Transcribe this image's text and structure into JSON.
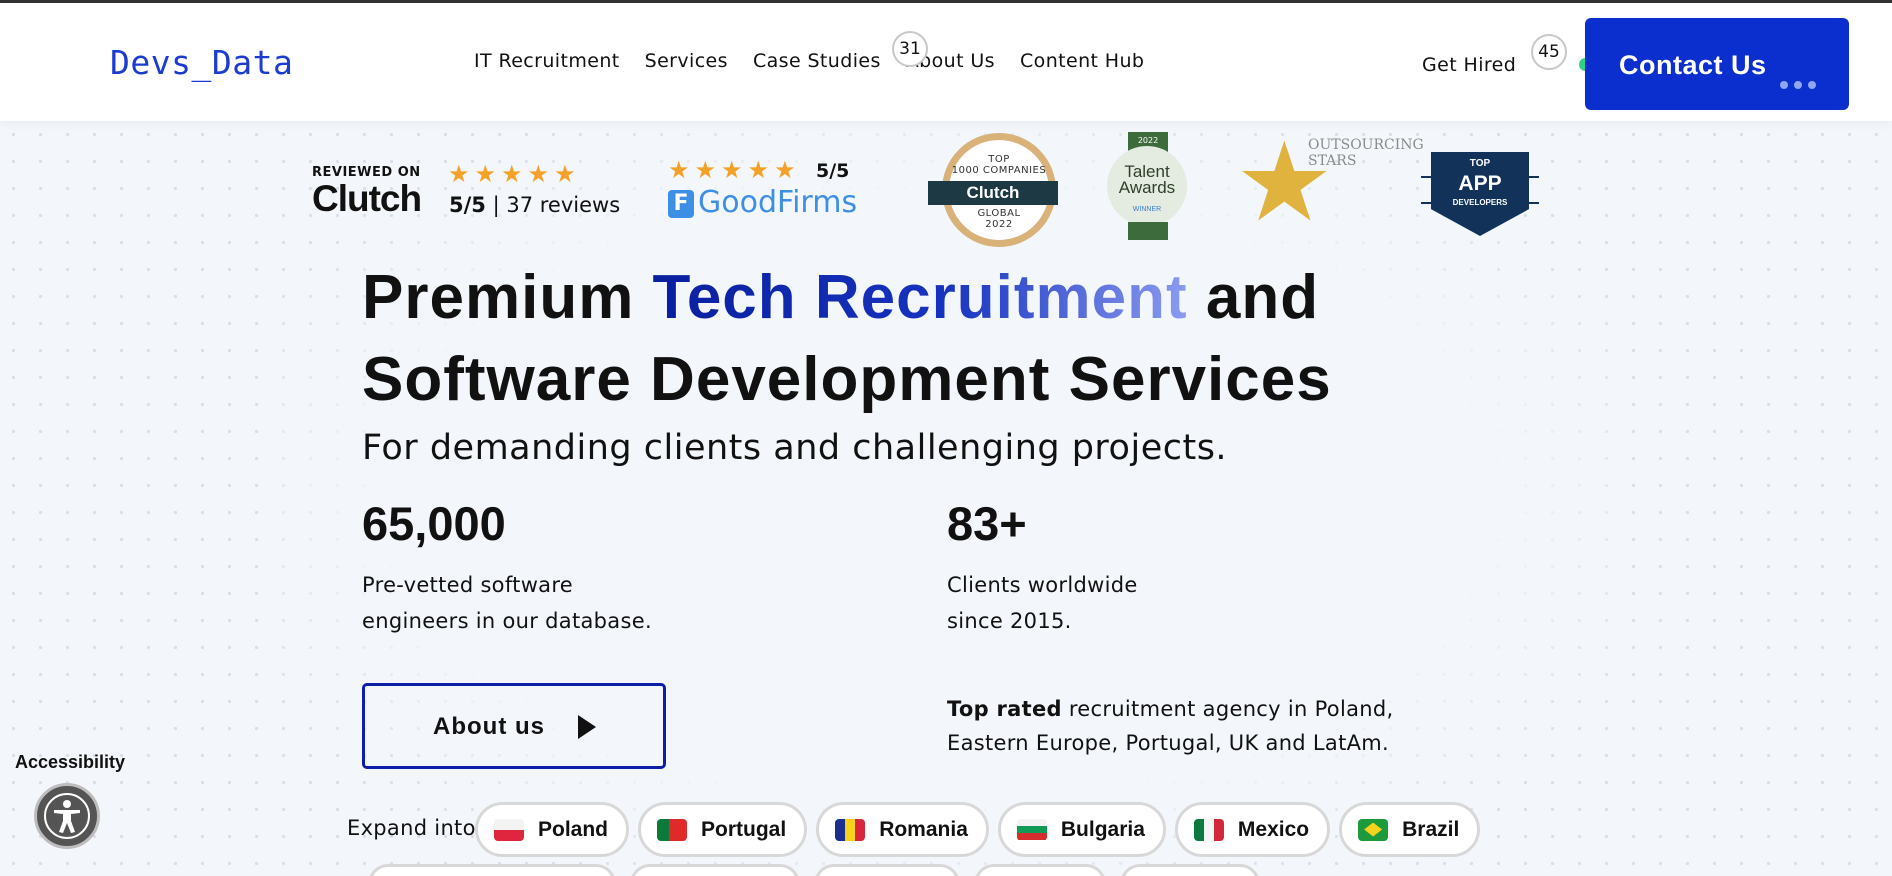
{
  "header": {
    "logo": "Devs_Data",
    "nav": [
      "IT Recruitment",
      "Services",
      "Case Studies",
      "About Us",
      "Content Hub"
    ],
    "case_studies_count": "31",
    "get_hired": "Get Hired",
    "get_hired_count": "45",
    "contact": "Contact Us"
  },
  "awards": {
    "clutch_reviewed_on": "REVIEWED ON",
    "clutch_name": "Clutch",
    "clutch_score": "5/5",
    "clutch_reviews": "37 reviews",
    "goodfirms_score": "5/5",
    "goodfirms_name": "GoodFirms",
    "clutch_top_line1": "TOP",
    "clutch_top_line2": "1000 COMPANIES",
    "clutch_top_brand": "Clutch",
    "clutch_top_global": "GLOBAL",
    "clutch_top_year": "2022",
    "talent_year": "2022",
    "talent_name_1": "Talent",
    "talent_name_2": "Awards",
    "talent_winner": "WINNER",
    "outsourcing_1": "OUTSOURCING",
    "outsourcing_2": "STARS",
    "app_top": "TOP",
    "app_name": "APP",
    "app_dev": "DEVELOPERS",
    "star_rating": 5
  },
  "hero": {
    "line1_pre": "Premium ",
    "line1_highlight": "Tech Recruitment",
    "line1_post": " and",
    "line2_bold": "Software Development",
    "line2_post": " Services",
    "subtitle": "For demanding clients and challenging projects."
  },
  "stats": [
    {
      "number": "65,000",
      "desc_1": "Pre-vetted software",
      "desc_2": "engineers in our database."
    },
    {
      "number": "83+",
      "desc_1": "Clients worldwide",
      "desc_2": "since 2015."
    }
  ],
  "about_button": "About us",
  "top_rated": {
    "bold": "Top rated",
    "line1_rest": " recruitment agency in Poland,",
    "line2": "Eastern Europe, Portugal, UK and LatAm."
  },
  "accessibility": {
    "label": "Accessibility"
  },
  "expand": {
    "label": "Expand into",
    "countries": [
      "Poland",
      "Portugal",
      "Romania",
      "Bulgaria",
      "Mexico",
      "Brazil"
    ]
  },
  "colors": {
    "brand_blue": "#0b2fcf",
    "accent_green": "#2ed283",
    "star_orange": "#f4a12a"
  }
}
